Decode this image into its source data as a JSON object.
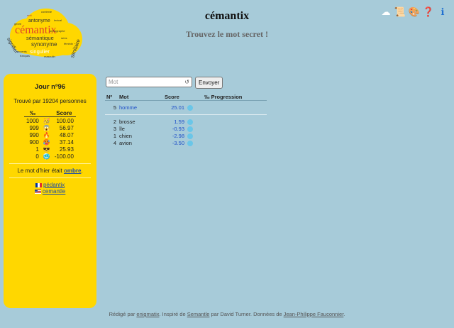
{
  "logo": {
    "title": "cémantix",
    "words": [
      "antonyme",
      "sémantique",
      "synonyme",
      "singulier",
      "signifier",
      "similaire",
      "contexte",
      "accents",
      "sens",
      "lexical",
      "français",
      "masculin",
      "féminin",
      "mot",
      "genre",
      "orthographe"
    ]
  },
  "header": {
    "title": "cémantix",
    "subtitle": "Trouvez le mot secret !",
    "icons": [
      "cloud-icon",
      "scroll-icon",
      "palette-icon",
      "help-icon",
      "info-icon"
    ],
    "icon_glyphs": [
      "☁",
      "📜",
      "🎨",
      "❓",
      "ℹ"
    ]
  },
  "sidebar": {
    "day": "Jour nº96",
    "found_by": "Trouvé par 19204 personnes",
    "stats_headers": [
      "‰",
      "Score"
    ],
    "stats": [
      {
        "rank": "1000",
        "emoji": "🥳",
        "score": "100.00"
      },
      {
        "rank": "999",
        "emoji": "😱",
        "score": "56.97"
      },
      {
        "rank": "990",
        "emoji": "🔥",
        "score": "48.07"
      },
      {
        "rank": "900",
        "emoji": "🥵",
        "score": "37.14"
      },
      {
        "rank": "1",
        "emoji": "😎",
        "score": "25.93"
      },
      {
        "rank": "0",
        "emoji": "🥶",
        "score": "-100.00"
      }
    ],
    "yesterday_prefix": "Le mot d'hier était ",
    "yesterday_word": "ombre",
    "yesterday_suffix": ".",
    "links": [
      {
        "flag": "fr",
        "label": "pédantix"
      },
      {
        "flag": "us",
        "label": "cemantle"
      }
    ]
  },
  "guess": {
    "placeholder": "Mot",
    "send_label": "Envoyer"
  },
  "guesses": {
    "headers": [
      "Nº",
      "Mot",
      "Score",
      "‰",
      "Progression"
    ],
    "last": {
      "n": "5",
      "word": "homme",
      "score": "25.01"
    },
    "rows": [
      {
        "n": "2",
        "word": "brosse",
        "score": "1.59"
      },
      {
        "n": "3",
        "word": "île",
        "score": "-0.93"
      },
      {
        "n": "1",
        "word": "chien",
        "score": "-2.98"
      },
      {
        "n": "4",
        "word": "avion",
        "score": "-3.50"
      }
    ]
  },
  "footer": {
    "t1": "Rédigé par ",
    "l1": "enigmatix",
    "t2": ". Inspiré de ",
    "l2": "Semantle",
    "t3": " par David Turner. Données de ",
    "l3": "Jean-Philippe Fauconnier",
    "t4": "."
  }
}
